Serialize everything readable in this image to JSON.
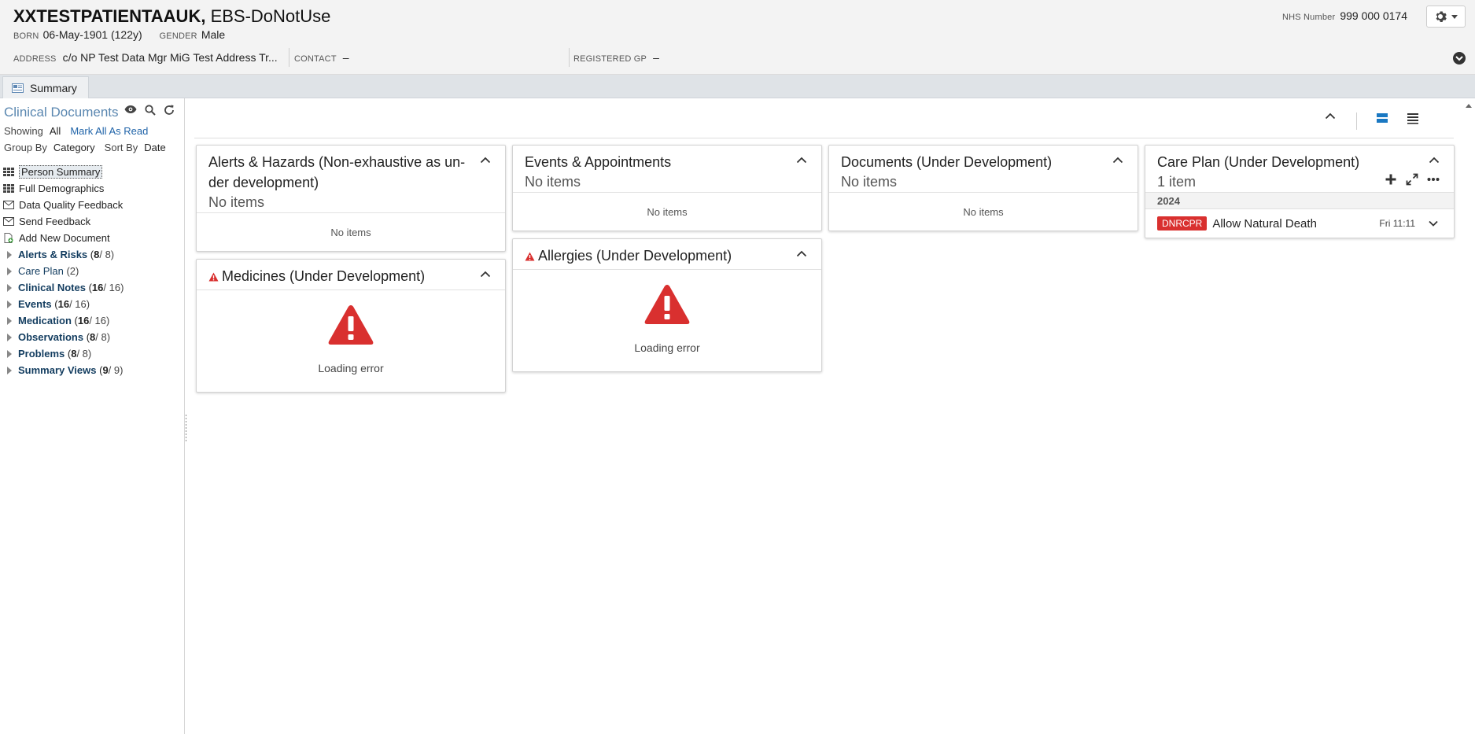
{
  "patient": {
    "surname": "XXTESTPATIENTAAUK,",
    "given": " EBS-DoNotUse",
    "born_label": "BORN",
    "born_value": "06-May-1901 (122y)",
    "gender_label": "GENDER",
    "gender_value": "Male",
    "address_label": "ADDRESS",
    "address_value": "c/o NP Test Data Mgr MiG Test Address Tr...",
    "contact_label": "CONTACT",
    "contact_value": "–",
    "gp_label": "REGISTERED GP",
    "gp_value": "–",
    "nhs_label": "NHS Number",
    "nhs_value": "999 000 0174"
  },
  "tabs": [
    {
      "label": "Summary"
    }
  ],
  "left": {
    "title": "Clinical Documents",
    "showing_label": "Showing",
    "showing_value": "All",
    "mark_read": "Mark All As Read",
    "group_label": "Group By",
    "group_value": "Category",
    "sort_label": "Sort By",
    "sort_value": "Date",
    "documents": [
      {
        "label": "Person Summary"
      },
      {
        "label": "Full Demographics"
      },
      {
        "label": "Data Quality Feedback"
      },
      {
        "label": "Send Feedback"
      },
      {
        "label": "Add New Document"
      }
    ],
    "categories": [
      {
        "name": "Alerts & Risks",
        "bold": "8",
        "rest": " / 8)"
      },
      {
        "name": "Care Plan",
        "plain": "(2)"
      },
      {
        "name": "Clinical Notes",
        "bold": "16",
        "rest": " / 16)"
      },
      {
        "name": "Events",
        "bold": "16",
        "rest": " / 16)"
      },
      {
        "name": "Medication",
        "bold": "16",
        "rest": " / 16)"
      },
      {
        "name": "Observations",
        "bold": "8",
        "rest": " / 8)"
      },
      {
        "name": "Problems",
        "bold": "8",
        "rest": " / 8)"
      },
      {
        "name": "Summary Views",
        "bold": "9",
        "rest": " / 9)"
      }
    ]
  },
  "cards": {
    "alerts": {
      "title": "Alerts & Hazards (Non-exhaustive as un-der development)",
      "sub": "No items",
      "body": "No items"
    },
    "medicines": {
      "title": "Medicines (Under Development)",
      "error": "Loading error"
    },
    "events": {
      "title": "Events & Appointments",
      "sub": "No items",
      "body": "No items"
    },
    "allergies": {
      "title": "Allergies (Under Development)",
      "error": "Loading error"
    },
    "documents": {
      "title": "Documents (Under Development)",
      "sub": "No items",
      "body": "No items"
    },
    "careplan": {
      "title": "Care Plan (Under Development)",
      "sub": "1 item",
      "year": "2024",
      "item_badge": "DNRCPR",
      "item_title": "Allow Natural Death",
      "item_time": "Fri 11:11"
    }
  },
  "colors": {
    "accent_link": "#1f63a8",
    "error_red": "#d9302f",
    "view_active": "#1a78c2"
  }
}
